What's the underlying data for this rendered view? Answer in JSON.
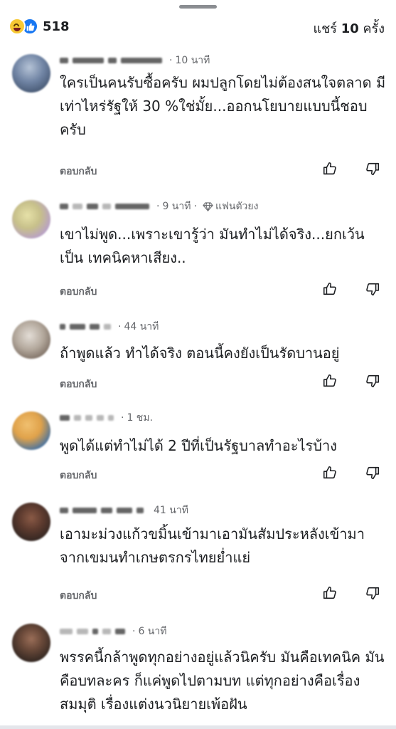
{
  "header": {
    "reaction_count": "518",
    "reactions": [
      "haha-icon",
      "like-icon"
    ],
    "shares_prefix": "แชร์",
    "shares_count": "10",
    "shares_suffix": "ครั้ง"
  },
  "comments": [
    {
      "time": "10 นาที",
      "badge": "",
      "text": "ใครเป็นคนรับซื้อครับ ผมปลูกโดยไม่ต้องสนใจตลาด มีเท่าไหร่รัฐให้ 30 %ใช่มั้ย...ออกนโยบายแบบนี้ชอบครับ",
      "reply_label": "ตอบกลับ",
      "avatar_colors": [
        "#9fb0c6",
        "#2f3f57"
      ]
    },
    {
      "time": "9 นาที",
      "badge": "แฟนตัวยง",
      "text": "เขาไม่พูด...เพราะเขารู้ว่า มันทำไม่ได้จริง...ยกเว้นเป็น เทคนิคหาเสียง..",
      "reply_label": "ตอบกลับ",
      "avatar_colors": [
        "#d9d49a",
        "#b8a0c8"
      ]
    },
    {
      "time": "44 นาที",
      "badge": "",
      "text": "ถ้าพูดแล้ว ทำได้จริง ตอนนี้คงยังเป็นรัดบานอยู่",
      "reply_label": "ตอบกลับ",
      "avatar_colors": [
        "#c9c0b6",
        "#5a4a40"
      ]
    },
    {
      "time": "1 ชม.",
      "badge": "",
      "text": "พูดได้แต่ทำไม่ได้ 2 ปีที่เป็นรัฐบาลทำอะไรบ้าง",
      "reply_label": "ตอบกลับ",
      "avatar_colors": [
        "#e0a24a",
        "#3b6fa8"
      ]
    },
    {
      "time": "41 นาที",
      "badge": "",
      "text": "เอามะม่วงแก้วขมิ้นเข้ามาเอามันสัมประหลังเข้ามาจากเขมนทำเกษตรกรไทยย่ำแย่",
      "reply_label": "ตอบกลับ",
      "avatar_colors": [
        "#5c3a2e",
        "#1a1a1a"
      ]
    },
    {
      "time": "6 นาที",
      "badge": "",
      "text": "พรรคนี้กล้าพูดทุกอย่างอยู่แล้วนิครับ มันคือเทคนิค มันคือบทละคร ก็แค่พูดไปตามบท แต่ทุกอย่างคือเรื่องสมมุติ เรื่องแต่งนวนิยายเพ้อฝัน",
      "reply_label": "",
      "avatar_colors": [
        "#6b4a3a",
        "#141414"
      ]
    }
  ],
  "colors": {
    "text": "#1c1e21",
    "secondary": "#65676b",
    "like_blue": "#1877f2",
    "haha_yellow": "#f7c933"
  }
}
